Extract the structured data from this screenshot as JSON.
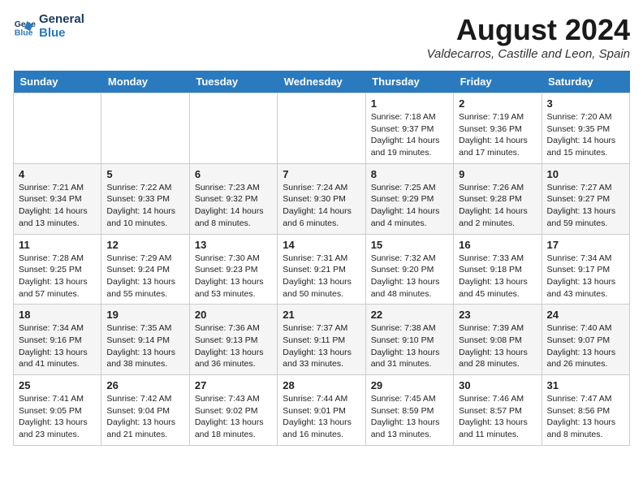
{
  "header": {
    "logo_line1": "General",
    "logo_line2": "Blue",
    "month_year": "August 2024",
    "location": "Valdecarros, Castille and Leon, Spain"
  },
  "days_of_week": [
    "Sunday",
    "Monday",
    "Tuesday",
    "Wednesday",
    "Thursday",
    "Friday",
    "Saturday"
  ],
  "weeks": [
    [
      {
        "day": "",
        "content": ""
      },
      {
        "day": "",
        "content": ""
      },
      {
        "day": "",
        "content": ""
      },
      {
        "day": "",
        "content": ""
      },
      {
        "day": "1",
        "content": "Sunrise: 7:18 AM\nSunset: 9:37 PM\nDaylight: 14 hours\nand 19 minutes."
      },
      {
        "day": "2",
        "content": "Sunrise: 7:19 AM\nSunset: 9:36 PM\nDaylight: 14 hours\nand 17 minutes."
      },
      {
        "day": "3",
        "content": "Sunrise: 7:20 AM\nSunset: 9:35 PM\nDaylight: 14 hours\nand 15 minutes."
      }
    ],
    [
      {
        "day": "4",
        "content": "Sunrise: 7:21 AM\nSunset: 9:34 PM\nDaylight: 14 hours\nand 13 minutes."
      },
      {
        "day": "5",
        "content": "Sunrise: 7:22 AM\nSunset: 9:33 PM\nDaylight: 14 hours\nand 10 minutes."
      },
      {
        "day": "6",
        "content": "Sunrise: 7:23 AM\nSunset: 9:32 PM\nDaylight: 14 hours\nand 8 minutes."
      },
      {
        "day": "7",
        "content": "Sunrise: 7:24 AM\nSunset: 9:30 PM\nDaylight: 14 hours\nand 6 minutes."
      },
      {
        "day": "8",
        "content": "Sunrise: 7:25 AM\nSunset: 9:29 PM\nDaylight: 14 hours\nand 4 minutes."
      },
      {
        "day": "9",
        "content": "Sunrise: 7:26 AM\nSunset: 9:28 PM\nDaylight: 14 hours\nand 2 minutes."
      },
      {
        "day": "10",
        "content": "Sunrise: 7:27 AM\nSunset: 9:27 PM\nDaylight: 13 hours\nand 59 minutes."
      }
    ],
    [
      {
        "day": "11",
        "content": "Sunrise: 7:28 AM\nSunset: 9:25 PM\nDaylight: 13 hours\nand 57 minutes."
      },
      {
        "day": "12",
        "content": "Sunrise: 7:29 AM\nSunset: 9:24 PM\nDaylight: 13 hours\nand 55 minutes."
      },
      {
        "day": "13",
        "content": "Sunrise: 7:30 AM\nSunset: 9:23 PM\nDaylight: 13 hours\nand 53 minutes."
      },
      {
        "day": "14",
        "content": "Sunrise: 7:31 AM\nSunset: 9:21 PM\nDaylight: 13 hours\nand 50 minutes."
      },
      {
        "day": "15",
        "content": "Sunrise: 7:32 AM\nSunset: 9:20 PM\nDaylight: 13 hours\nand 48 minutes."
      },
      {
        "day": "16",
        "content": "Sunrise: 7:33 AM\nSunset: 9:18 PM\nDaylight: 13 hours\nand 45 minutes."
      },
      {
        "day": "17",
        "content": "Sunrise: 7:34 AM\nSunset: 9:17 PM\nDaylight: 13 hours\nand 43 minutes."
      }
    ],
    [
      {
        "day": "18",
        "content": "Sunrise: 7:34 AM\nSunset: 9:16 PM\nDaylight: 13 hours\nand 41 minutes."
      },
      {
        "day": "19",
        "content": "Sunrise: 7:35 AM\nSunset: 9:14 PM\nDaylight: 13 hours\nand 38 minutes."
      },
      {
        "day": "20",
        "content": "Sunrise: 7:36 AM\nSunset: 9:13 PM\nDaylight: 13 hours\nand 36 minutes."
      },
      {
        "day": "21",
        "content": "Sunrise: 7:37 AM\nSunset: 9:11 PM\nDaylight: 13 hours\nand 33 minutes."
      },
      {
        "day": "22",
        "content": "Sunrise: 7:38 AM\nSunset: 9:10 PM\nDaylight: 13 hours\nand 31 minutes."
      },
      {
        "day": "23",
        "content": "Sunrise: 7:39 AM\nSunset: 9:08 PM\nDaylight: 13 hours\nand 28 minutes."
      },
      {
        "day": "24",
        "content": "Sunrise: 7:40 AM\nSunset: 9:07 PM\nDaylight: 13 hours\nand 26 minutes."
      }
    ],
    [
      {
        "day": "25",
        "content": "Sunrise: 7:41 AM\nSunset: 9:05 PM\nDaylight: 13 hours\nand 23 minutes."
      },
      {
        "day": "26",
        "content": "Sunrise: 7:42 AM\nSunset: 9:04 PM\nDaylight: 13 hours\nand 21 minutes."
      },
      {
        "day": "27",
        "content": "Sunrise: 7:43 AM\nSunset: 9:02 PM\nDaylight: 13 hours\nand 18 minutes."
      },
      {
        "day": "28",
        "content": "Sunrise: 7:44 AM\nSunset: 9:01 PM\nDaylight: 13 hours\nand 16 minutes."
      },
      {
        "day": "29",
        "content": "Sunrise: 7:45 AM\nSunset: 8:59 PM\nDaylight: 13 hours\nand 13 minutes."
      },
      {
        "day": "30",
        "content": "Sunrise: 7:46 AM\nSunset: 8:57 PM\nDaylight: 13 hours\nand 11 minutes."
      },
      {
        "day": "31",
        "content": "Sunrise: 7:47 AM\nSunset: 8:56 PM\nDaylight: 13 hours\nand 8 minutes."
      }
    ]
  ]
}
